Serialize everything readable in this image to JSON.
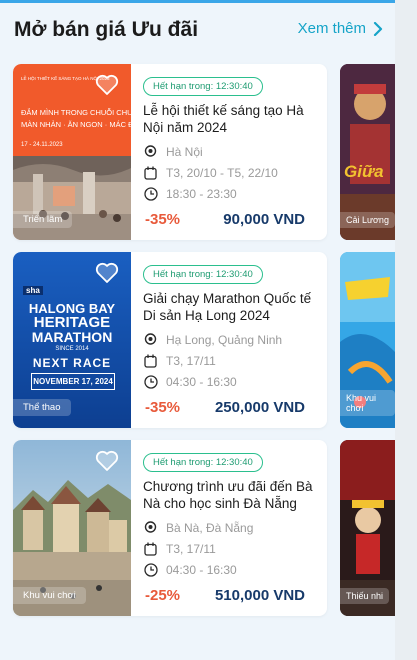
{
  "section": {
    "title": "Mở bán giá Ưu đãi",
    "more_label": "Xem thêm"
  },
  "colors": {
    "accent": "#16a4c8",
    "discount": "#e85a3b",
    "price": "#173a6a",
    "badge": "#2bbf8e"
  },
  "events": [
    {
      "badge": "Hết hạn trong: 12:30:40",
      "name": "Lễ hội thiết kế sáng tạo Hà Nội năm 2024",
      "location": "Hà Nội",
      "date": "T3, 20/10 - T5, 22/10",
      "time": "18:30 - 23:30",
      "discount": "-35%",
      "price": "90,000 VND",
      "category": "Triển lãm",
      "poster_lines": [
        "ĐẮM MÌNH TRONG CHUỖI CHUỖI",
        "MÀN NHẢN · ĂN NGON · MÁC Đ",
        "17 - 24.11.2023"
      ],
      "poster_small": "LỄ HỘI THIẾT KẾ SÁNG TẠO HÀ NỘI 2023"
    },
    {
      "badge": "Hết hạn trong: 12:30:40",
      "name": "Giải chạy Marathon Quốc tế Di sản Hạ Long 2024",
      "location": "Hạ Long, Quảng Ninh",
      "date": "T3, 17/11",
      "time": "04:30 - 16:30",
      "discount": "-35%",
      "price": "250,000 VND",
      "category": "Thể thao",
      "poster_lines": [
        "HALONG BAY",
        "HERITAGE",
        "MARATHON",
        "SINCE 2014",
        "NEXT RACE",
        "NOVEMBER 17, 2024"
      ],
      "poster_small": "sha"
    },
    {
      "badge": "Hết hạn trong: 12:30:40",
      "name": "Chương trình ưu đãi đến Bà Nà cho học sinh Đà Nẵng",
      "location": "Bà Nà, Đà Nẵng",
      "date": "T3, 17/11",
      "time": "04:30 - 16:30",
      "discount": "-25%",
      "price": "510,000 VND",
      "category": "Khu vui chơi"
    }
  ],
  "side_cards": [
    {
      "category": "Cải Lương",
      "poster_text": "Giữa"
    },
    {
      "category": "Khu vui chơi"
    },
    {
      "category": "Thiếu nhi"
    }
  ]
}
